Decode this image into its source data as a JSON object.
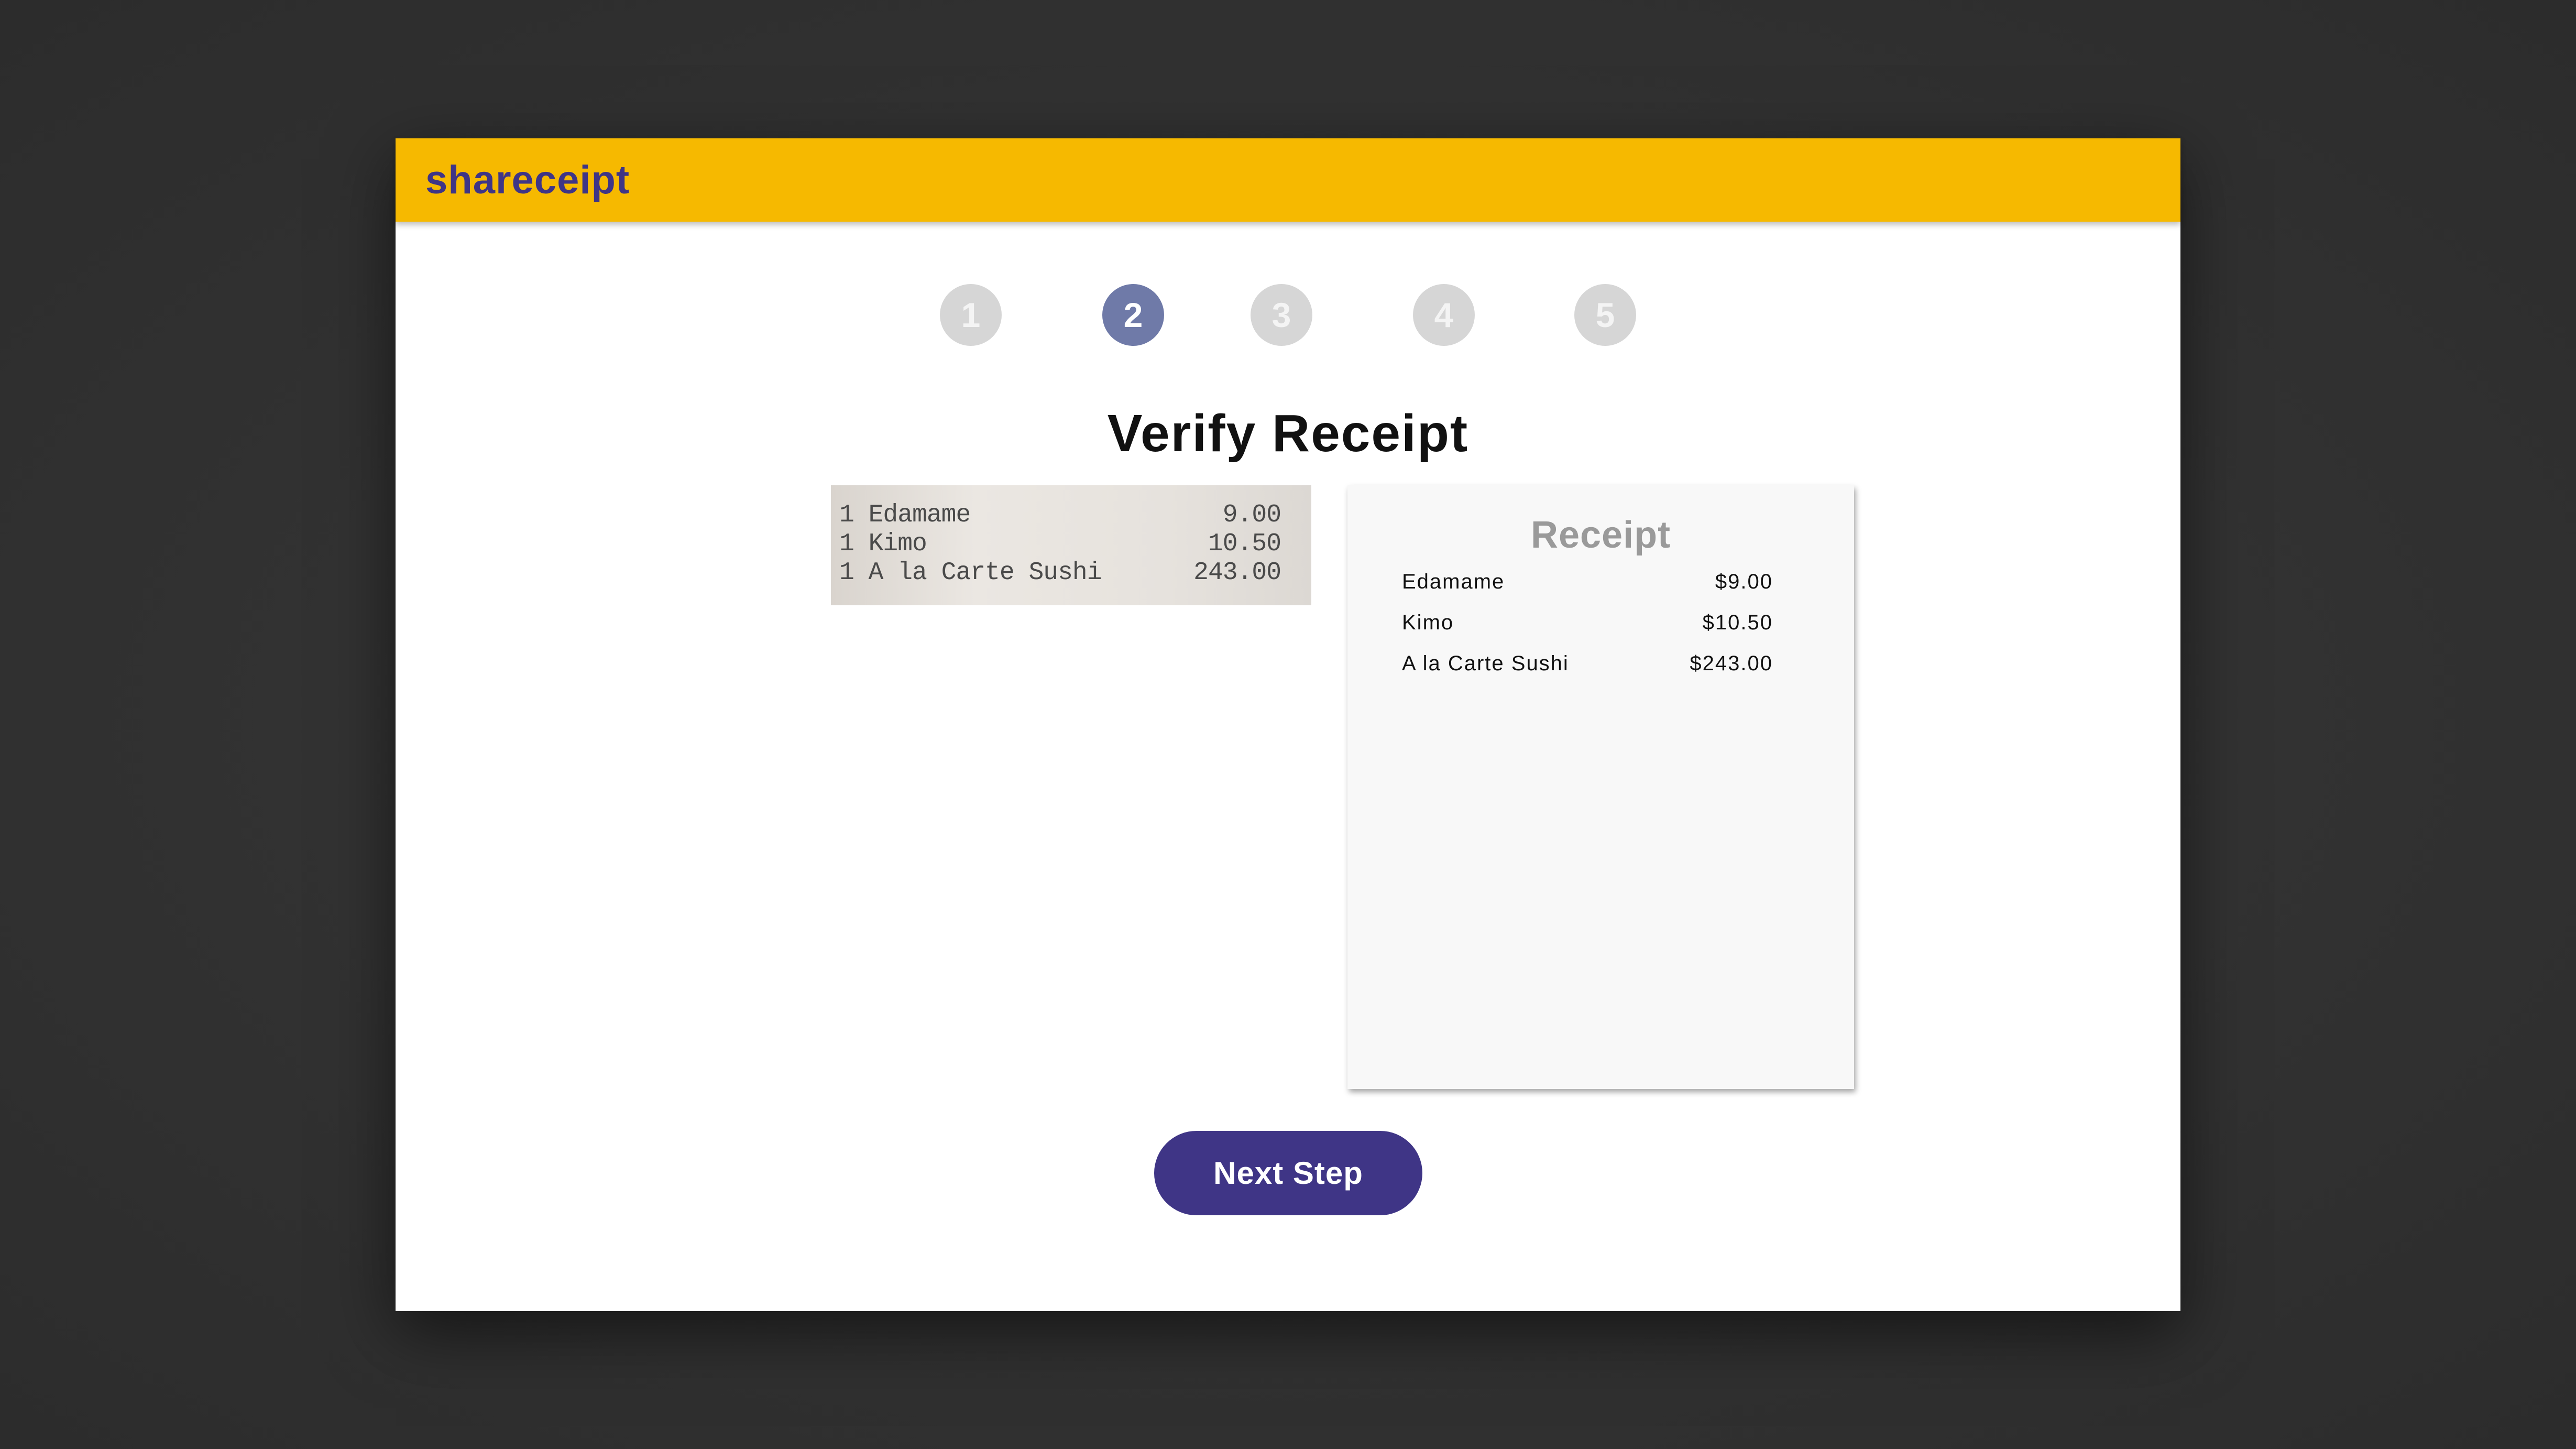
{
  "app": {
    "brand": "shareceipt"
  },
  "stepper": {
    "steps": [
      "1",
      "2",
      "3",
      "4",
      "5"
    ],
    "active_step": "2"
  },
  "page": {
    "title": "Verify Receipt"
  },
  "receipt_photo": {
    "rows": [
      {
        "name": "1 Edamame",
        "amount": "9.00"
      },
      {
        "name": "1 Kimo",
        "amount": "10.50"
      },
      {
        "name": "1 A la Carte Sushi",
        "amount": "243.00"
      }
    ]
  },
  "receipt": {
    "title": "Receipt",
    "items": [
      {
        "name": "Edamame",
        "price": "$9.00"
      },
      {
        "name": "Kimo",
        "price": "$10.50"
      },
      {
        "name": "A la Carte Sushi",
        "price": "$243.00"
      }
    ]
  },
  "actions": {
    "next_label": "Next Step"
  },
  "colors": {
    "header": "#f6b900",
    "brand_text": "#3f3586",
    "active_step": "#6f7aa8",
    "inactive_step": "#d6d6d6",
    "primary_button": "#3f3586"
  }
}
